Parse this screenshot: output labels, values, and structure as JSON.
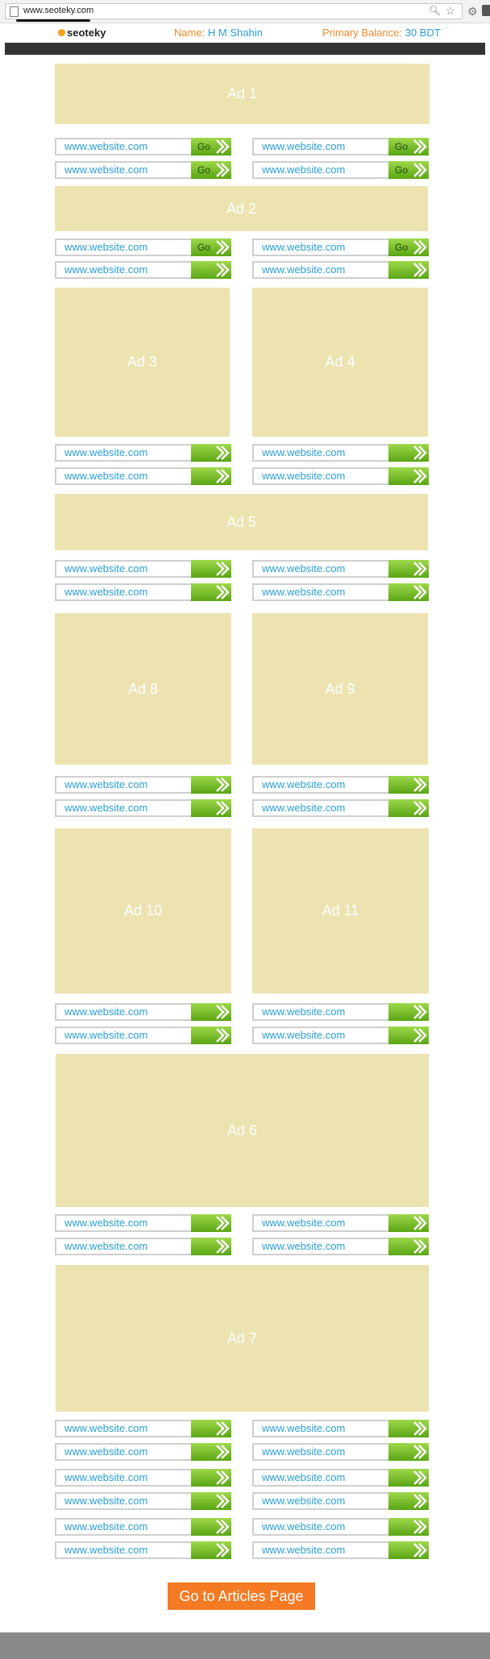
{
  "browser": {
    "url": "www.seoteky.com"
  },
  "header": {
    "logo": "seoteky",
    "name_label": "Name:",
    "name_value": "H M Shahin",
    "balance_label": "Primary Balance:",
    "balance_value": "30 BDT"
  },
  "ads": {
    "ad1": "Ad 1",
    "ad2": "Ad 2",
    "ad3": "Ad 3",
    "ad4": "Ad 4",
    "ad5": "Ad 5",
    "ad8": "Ad 8",
    "ad9": "Ad 9",
    "ad10": "Ad 10",
    "ad11": "Ad 11",
    "ad6": "Ad 6",
    "ad7": "Ad 7"
  },
  "links": {
    "website": "www.website.com",
    "go_label": "Go"
  },
  "cta": {
    "label": "Go to Articles Page"
  }
}
